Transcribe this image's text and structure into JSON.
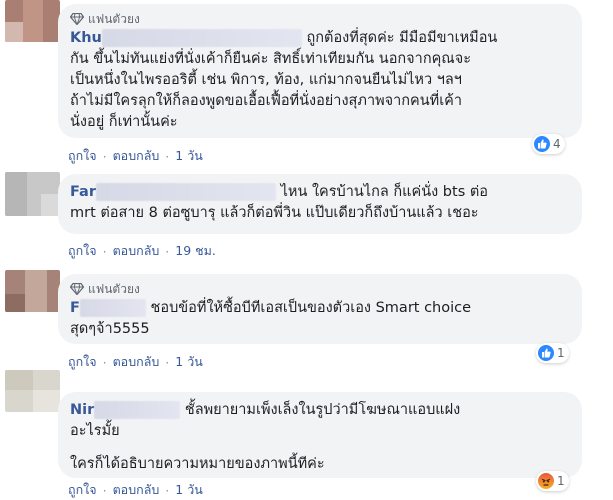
{
  "badge_label": "แฟนตัวยง",
  "like_label": "ถูกใจ",
  "reply_label": "ตอบกลับ",
  "comments": [
    {
      "name_prefix": "Khu",
      "lines": [
        "ถูกต้องที่สุดค่ะ มีมือมีขาเหมือน",
        "กัน ขึ้นไม่ทันแย่งที่นั่งเค้าก็ยืนค่ะ สิทธิ์เท่าเทียมกัน นอกจากคุณจะ",
        "เป็นหนึ่งในไพรออริตี้ เช่น พิการ, ท้อง, แก่มากจนยืนไม่ไหว ฯลฯ",
        "ถ้าไม่มีใครลุกให้ก็ลองพูดขอเอื้อเฟื้อที่นั่งอย่างสุภาพจากคนที่เค้า",
        "นั่งอยู่ ก็เท่านั้นค่ะ"
      ],
      "time": "1 วัน",
      "reaction_type": "like",
      "reaction_count": "4"
    },
    {
      "name_prefix": "Far",
      "lines": [
        "ไหน ใครบ้านไกล ก็แค่นั่ง bts ต่อ",
        "mrt ต่อสาย 8 ต่อซูบารุ แล้วก็ต่อพี่วิน แป๊บเดียวก็ถึงบ้านแล้ว เชอะ"
      ],
      "time": "19 ชม."
    },
    {
      "name_prefix": "F",
      "lines": [
        "ชอบข้อที่ให้ซื้อบีทีเอสเป็นของตัวเอง Smart choice",
        "สุดๆจ้า5555"
      ],
      "time": "1 วัน",
      "reaction_type": "like",
      "reaction_count": "1"
    },
    {
      "name_prefix": "Nir",
      "lines": [
        "ชั้ลพยายามเพ็งเล็งในรูปว่ามีโฆษณาแอบแฝง",
        "อะไรมั้ย",
        "ใครก็ได้อธิบายความหมายของภาพนี้ทีค่ะ"
      ],
      "time": "1 วัน",
      "reaction_type": "angry",
      "reaction_count": "1"
    }
  ]
}
